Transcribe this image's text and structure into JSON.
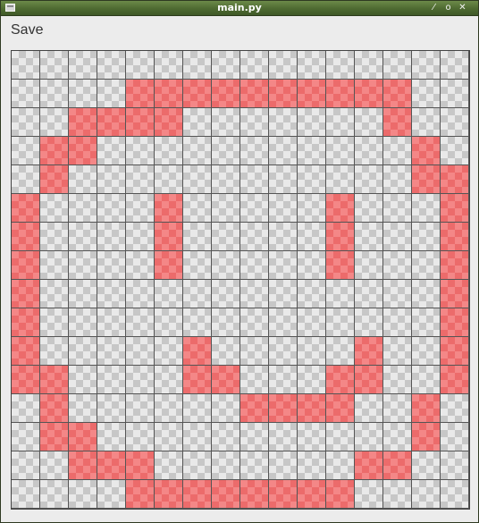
{
  "window": {
    "title": "main.py",
    "controls": [
      {
        "name": "minimize-icon",
        "glyph": "⁄"
      },
      {
        "name": "maximize-icon",
        "glyph": "o"
      },
      {
        "name": "close-icon",
        "glyph": "✕"
      }
    ]
  },
  "toolbar": {
    "save_label": "Save"
  },
  "pixel_grid": {
    "columns": 16,
    "rows": 16,
    "fill_color": "#f48787",
    "empty_pattern": "checkerboard",
    "filled": [
      "................",
      "................",
      "....xxxxxxxxxx..",
      "..xxxx.......x..",
      ".xx...........x.",
      ".x............xx",
      "x....x.....x...x",
      "x....x.....x...x",
      "x....x.....x...x",
      "x..............x",
      "x..............x",
      "x.....x.....x..x",
      "xx....xx...xx..x",
      ".x......xxxx..x.",
      ".xx...........x.",
      "..xxx.......xx..",
      "....xxxxxxxx...."
    ]
  }
}
